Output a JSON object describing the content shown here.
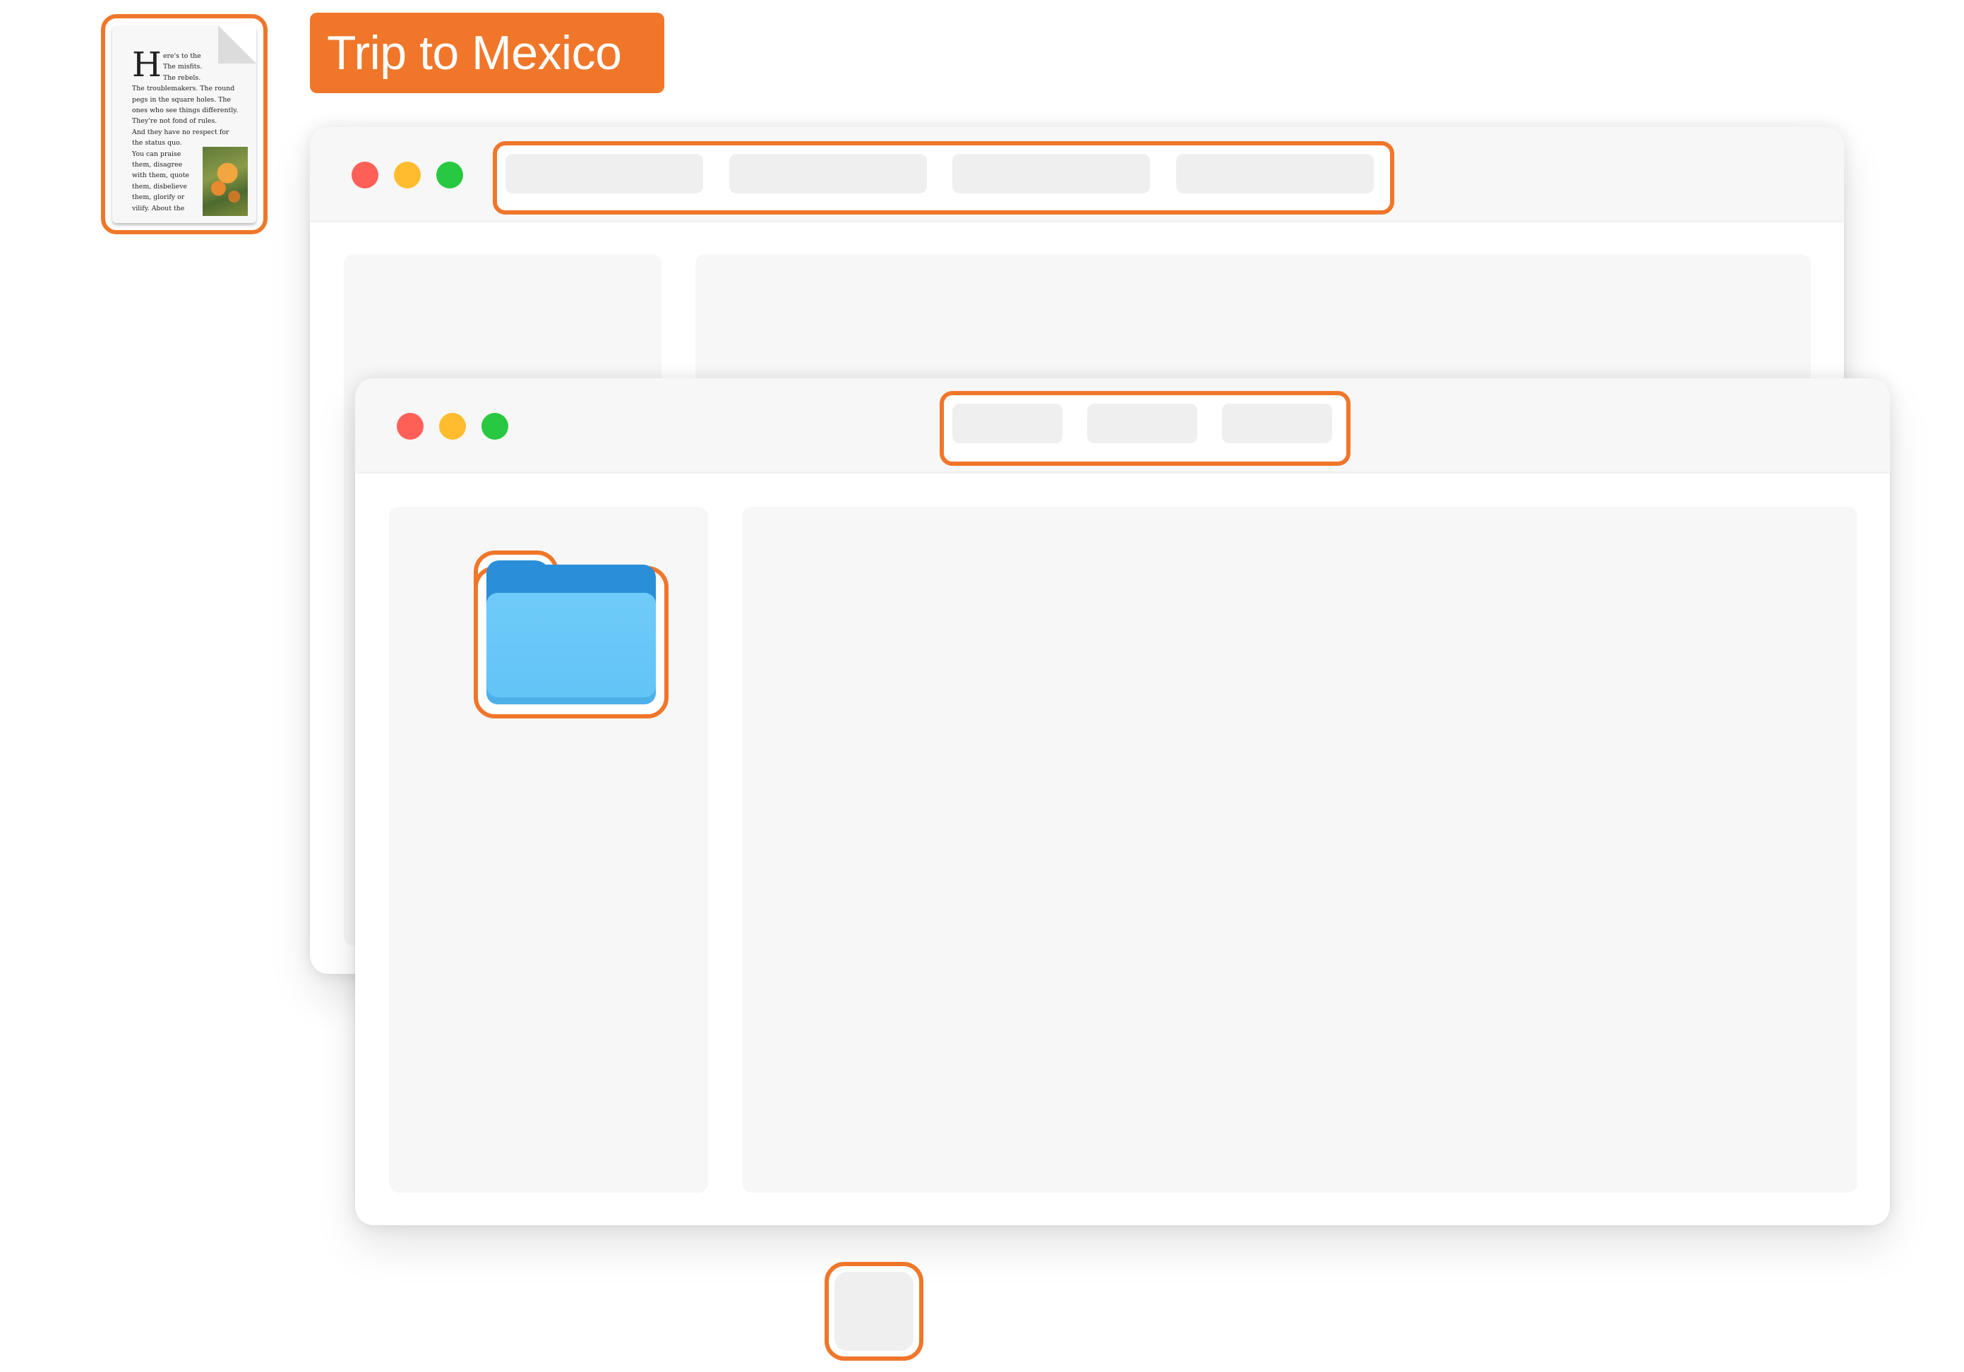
{
  "title_badge": {
    "text": "Trip to Mexico"
  },
  "document": {
    "dropcap": "H",
    "lines": [
      "ere's to the",
      "The misfits.",
      "The rebels.",
      "The troublemakers. The round",
      "pegs in the square holes. The",
      "ones who see things differently.",
      "They're not fond of rules.",
      "And they have no respect for",
      "the status quo.",
      "You can praise",
      "them, disagree",
      "with them, quote",
      "them, disbelieve",
      "them, glorify or",
      "vilify. About the"
    ]
  },
  "colors": {
    "accent": "#f0762a",
    "close": "#fe5f57",
    "minimize": "#febc2e",
    "zoom": "#28c840",
    "folder": "#6fcbf9"
  },
  "icons": [
    "document-icon",
    "folder-icon",
    "traffic-light-close",
    "traffic-light-minimize",
    "traffic-light-zoom"
  ]
}
